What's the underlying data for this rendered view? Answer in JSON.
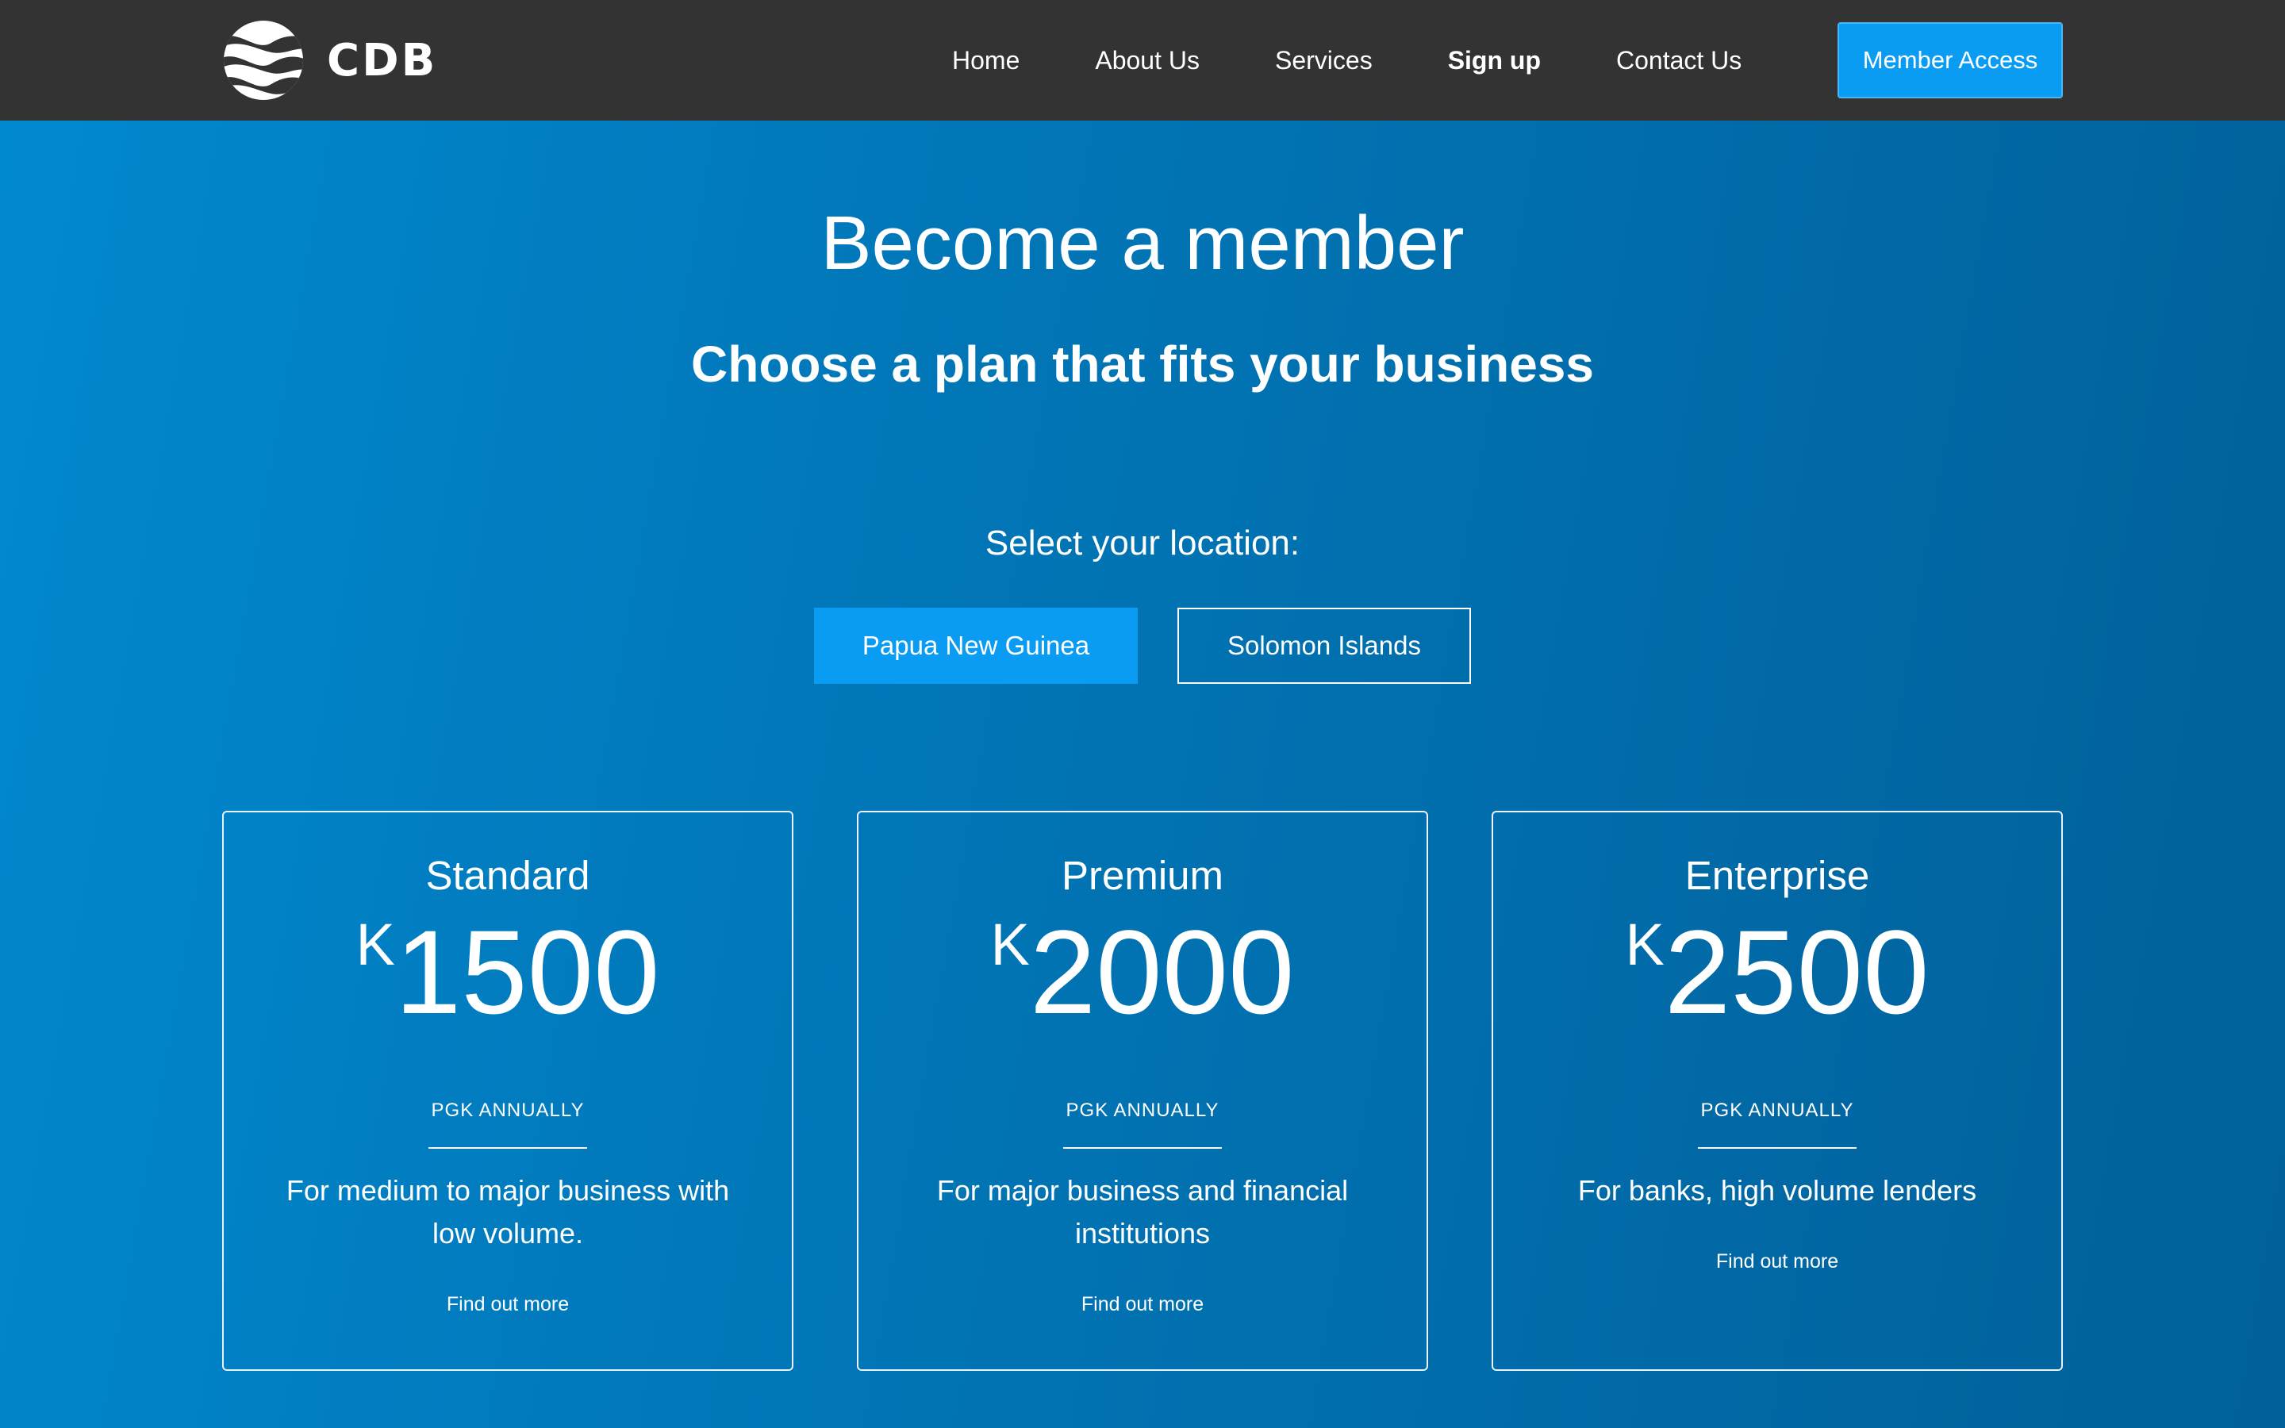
{
  "header": {
    "logo_text": "CDB",
    "nav": [
      "Home",
      "About Us",
      "Services",
      "Sign up",
      "Contact Us"
    ],
    "member_access_label": "Member Access",
    "background_color": "#333333",
    "accent_color": "#0a9cf2"
  },
  "hero": {
    "title": "Become a member",
    "subtitle": "Choose a plan that fits your business",
    "location_label": "Select your location:",
    "locations": [
      {
        "label": "Papua New Guinea",
        "selected": true
      },
      {
        "label": "Solomon Islands",
        "selected": false
      }
    ]
  },
  "plans": [
    {
      "name": "Standard",
      "currency": "K",
      "price": "1500",
      "period": "PGK ANNUALLY",
      "description": "For medium to major business with low volume.",
      "link": "Find out more"
    },
    {
      "name": "Premium",
      "currency": "K",
      "price": "2000",
      "period": "PGK ANNUALLY",
      "description": "For major business and financial institutions",
      "link": "Find out more"
    },
    {
      "name": "Enterprise",
      "currency": "K",
      "price": "2500",
      "period": "PGK ANNUALLY",
      "description": "For banks, high volume lenders",
      "link": "Find out more"
    }
  ]
}
